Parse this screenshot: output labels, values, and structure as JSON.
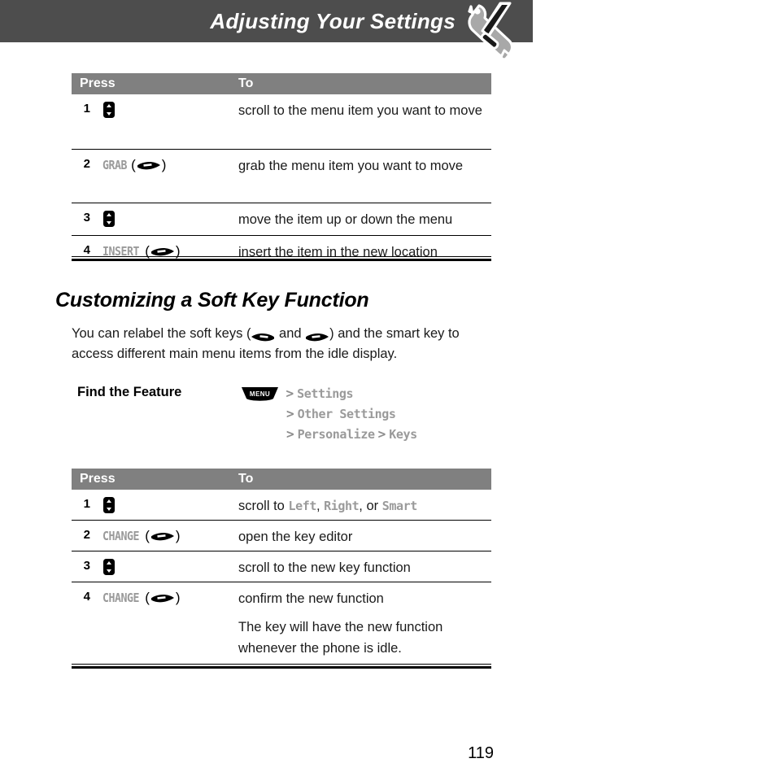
{
  "header": {
    "title": "Adjusting Your Settings",
    "icon": "wrench-screwdriver-icon"
  },
  "table1": {
    "columns": [
      "Press",
      "To"
    ],
    "rows": [
      {
        "num": "1",
        "key_icon": "scroll-key-icon",
        "key_label": "",
        "desc": "scroll to the menu item you want to move"
      },
      {
        "num": "2",
        "key_icon": "right-soft-key-icon",
        "key_label": "GRAB",
        "desc": "grab the menu item you want to move"
      },
      {
        "num": "3",
        "key_icon": "scroll-key-icon",
        "key_label": "",
        "desc": "move the item up or down the menu"
      },
      {
        "num": "4",
        "key_icon": "right-soft-key-icon",
        "key_label": "INSERT",
        "desc": "insert the item in the new location"
      }
    ]
  },
  "section": {
    "heading": "Customizing a Soft Key Function",
    "body_part1": "You can relabel the soft keys (",
    "body_and": " and ",
    "body_part2": ") and the smart key to access different main menu items from the idle display.",
    "left_soft_key_icon": "left-soft-key-icon",
    "right_soft_key_icon": "right-soft-key-icon"
  },
  "find_the_feature": {
    "label": "Find the Feature",
    "menu_key": "MENU",
    "separator": ">",
    "path": [
      "Settings",
      "Other Settings",
      "Personalize",
      "Keys"
    ]
  },
  "table2": {
    "columns": [
      "Press",
      "To"
    ],
    "rows": [
      {
        "num": "1",
        "key_icon": "scroll-key-icon",
        "key_label": "",
        "desc_prefix": "scroll to ",
        "desc_opt1": "Left",
        "desc_sep1": ", ",
        "desc_opt2": "Right",
        "desc_sep2": ", or ",
        "desc_opt3": "Smart"
      },
      {
        "num": "2",
        "key_icon": "right-soft-key-icon",
        "key_label": "CHANGE",
        "desc": "open the key editor"
      },
      {
        "num": "3",
        "key_icon": "scroll-key-icon",
        "key_label": "",
        "desc": "scroll to the new key function"
      },
      {
        "num": "4",
        "key_icon": "right-soft-key-icon",
        "key_label": "CHANGE",
        "desc": "confirm the new function",
        "desc2": "The key will have the new function whenever the phone is idle."
      }
    ]
  },
  "footer": {
    "page_number": "119"
  },
  "colors": {
    "banner": "#4d4d4d",
    "table_header": "#808080",
    "lcd_text": "#9a9a9a",
    "body_text": "#1a1a1a"
  }
}
